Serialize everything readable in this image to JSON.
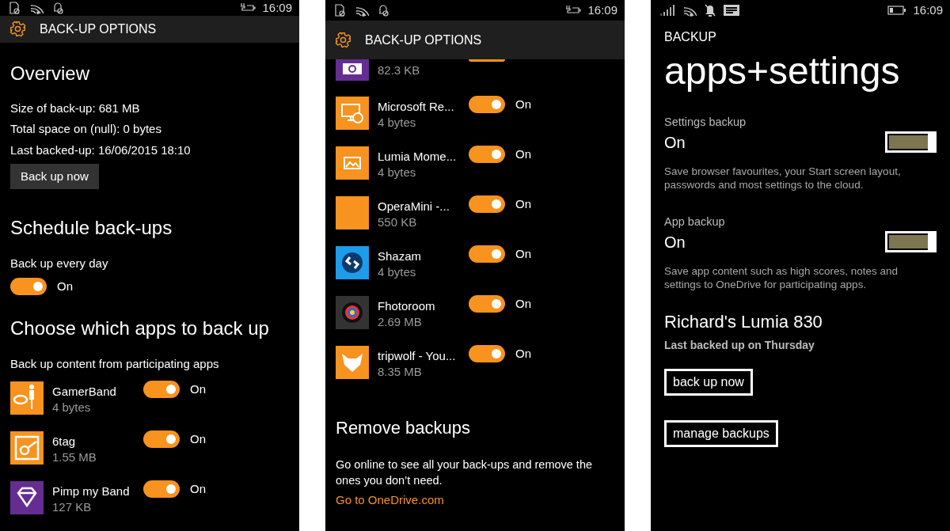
{
  "options_screen": {
    "status_bar": {
      "time": "16:09"
    },
    "header": {
      "title": "BACK-UP OPTIONS"
    },
    "overview": {
      "heading": "Overview",
      "lines": [
        "Size of back-up: 681 MB",
        "Total space on (null): 0 bytes",
        "Last backed-up: 16/06/2015 18:10"
      ],
      "button": "Back up now"
    },
    "schedule": {
      "heading": "Schedule back-ups",
      "label": "Back up every day",
      "on": true,
      "state_label": "On"
    },
    "apps_section": {
      "heading": "Choose which apps to back up",
      "description": "Back up content from participating apps"
    },
    "apps": [
      {
        "name": "GamerBand",
        "size": "4 bytes",
        "color": "#f7931e",
        "on": true,
        "state_label": "On"
      },
      {
        "name": "6tag",
        "size": "1.55 MB",
        "color": "#f7931e",
        "on": true,
        "state_label": "On"
      },
      {
        "name": "Pimp my Band",
        "size": "127 KB",
        "color": "#652d91",
        "on": true,
        "state_label": "On"
      }
    ]
  },
  "options_screen_scrolled": {
    "status_bar": {
      "time": "16:09"
    },
    "header": {
      "title": "BACK-UP OPTIONS"
    },
    "apps": [
      {
        "size": "82.3 KB",
        "color": "#652d91",
        "on": true
      },
      {
        "name": "Microsoft Re...",
        "size": "4 bytes",
        "color": "#f7931e",
        "on": true,
        "state_label": "On"
      },
      {
        "name": "Lumia Mome...",
        "size": "4 bytes",
        "color": "#f7931e",
        "on": true,
        "state_label": "On"
      },
      {
        "name": "OperaMini -...",
        "size": "550 KB",
        "color": "#f7931e",
        "on": true,
        "state_label": "On"
      },
      {
        "name": "Shazam",
        "size": "4 bytes",
        "color": "#1e9be9",
        "on": true,
        "state_label": "On"
      },
      {
        "name": "Fhotoroom",
        "size": "2.69 MB",
        "color": "#333333",
        "on": true,
        "state_label": "On"
      },
      {
        "name": "tripwolf - You...",
        "size": "8.35 MB",
        "color": "#f7931e",
        "on": true,
        "state_label": "On"
      }
    ],
    "remove_section": {
      "heading": "Remove backups",
      "text": "Go online to see all your back-ups and remove the ones you don’t need.",
      "link": "Go to OneDrive.com"
    }
  },
  "backup_screen": {
    "status_bar": {
      "time": "16:09"
    },
    "app_title": "BACKUP",
    "page_title": "apps+settings",
    "settings": [
      {
        "label": "Settings backup",
        "value": "On",
        "on": true,
        "description": "Save browser favourites, your Start screen layout, passwords and most settings to the cloud."
      },
      {
        "label": "App backup",
        "value": "On",
        "on": true,
        "description": "Save app content such as high scores, notes and settings to OneDrive for participating apps."
      }
    ],
    "device": {
      "name": "Richard's Lumia 830",
      "last_backup": "Last backed up on Thursday"
    },
    "buttons": [
      "back up now",
      "manage backups"
    ]
  }
}
